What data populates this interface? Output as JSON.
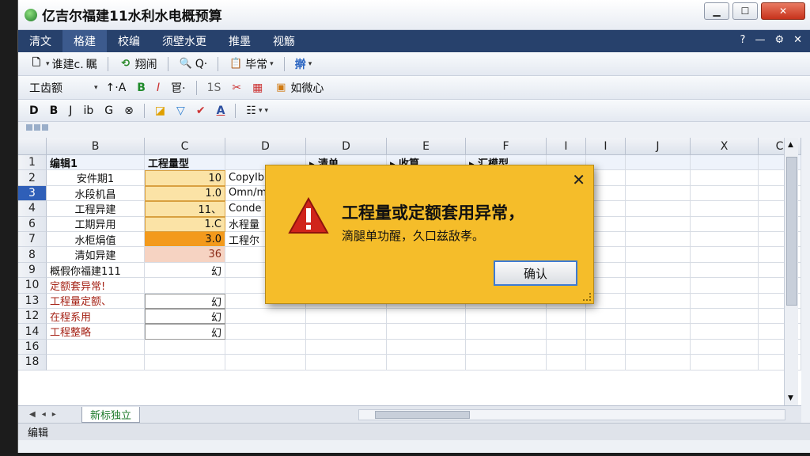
{
  "window": {
    "title": "亿吉尔福建11水利水电概预算",
    "buttons": [
      "▁",
      "☐",
      "✕"
    ]
  },
  "menu": {
    "items": [
      "清文",
      "格建",
      "校编",
      "须壁水更",
      "推墨",
      "视觞"
    ],
    "active_index": 1,
    "right_icons": [
      "?",
      "—",
      "⚙",
      "✕"
    ]
  },
  "toolbar1": {
    "new_label": "谁建c.",
    "new_suffix": "瞩",
    "undo_label": "翔闹",
    "zoom_label": "Q·",
    "paste_label": "毕常",
    "format_label": "擀"
  },
  "toolbar2": {
    "font_name": "工齿额",
    "sort_label": "↑·A",
    "bold": "B",
    "italic": "I",
    "list": "冟·",
    "rows": "1S",
    "scissors": "✂",
    "grid": "▦",
    "center_label": "如微心"
  },
  "toolbar3": {
    "btns": [
      "D",
      "B",
      "J",
      "ⅰb",
      "G",
      "⊗"
    ],
    "paint_icons": [
      "◪",
      "▽",
      "✔",
      "A"
    ],
    "border_label": "☷"
  },
  "columns": [
    "B",
    "C",
    "D",
    "D",
    "E",
    "F",
    "I",
    "I",
    "J",
    "X",
    "C"
  ],
  "rows": {
    "numbers": [
      "1",
      "2",
      "3",
      "4",
      "6",
      "7",
      "8",
      "9",
      "10",
      "13",
      "12",
      "14",
      "16",
      "18"
    ],
    "selected_row": "3",
    "cells": [
      [
        "编辑1",
        "工程量型",
        "",
        "▸ 清单",
        "▸ 收算",
        "▸ 汇模型"
      ],
      [
        "安件期1",
        "10",
        "CopyIb",
        "",
        "",
        ""
      ],
      [
        "水段机昌",
        "1.0",
        "Omn/m",
        "",
        "",
        ""
      ],
      [
        "工程异建",
        "11、",
        "Conde",
        "",
        "",
        ""
      ],
      [
        "工期异用",
        "1.C",
        "水程量",
        "",
        "",
        ""
      ],
      [
        "水柜焆值",
        "3.0",
        "工程尔",
        "",
        "",
        ""
      ],
      [
        "清如异建",
        "36",
        "",
        "",
        "",
        ""
      ],
      [
        "概假你福建111",
        "幻",
        "",
        "",
        "",
        ""
      ],
      [
        "定额套异常!",
        "",
        "",
        "",
        "",
        ""
      ],
      [
        "工程量定额、",
        "幻",
        "",
        "",
        "",
        ""
      ],
      [
        "在程系用",
        "幻",
        "",
        "",
        "",
        ""
      ],
      [
        "工程整略",
        "幻",
        "",
        "",
        "",
        ""
      ],
      [
        "",
        "",
        "",
        "",
        "",
        ""
      ],
      [
        "",
        "",
        "",
        "",
        "",
        ""
      ]
    ]
  },
  "sheet": {
    "tab_label": "新标独立"
  },
  "status": {
    "text": "编辑"
  },
  "dialog": {
    "title": "工程量或定额套用异常，",
    "message": "滴腿单功醒，久口兹敌孝。",
    "confirm_label": "确认",
    "close_label": "✕"
  },
  "colors": {
    "menubar": "#27416c",
    "dialog": "#f5bd2a",
    "selected_row": "#2f5fb8",
    "highlight_orange": "#f39a1c",
    "highlight_light": "#fbe3a6",
    "error_text": "#a52317"
  }
}
